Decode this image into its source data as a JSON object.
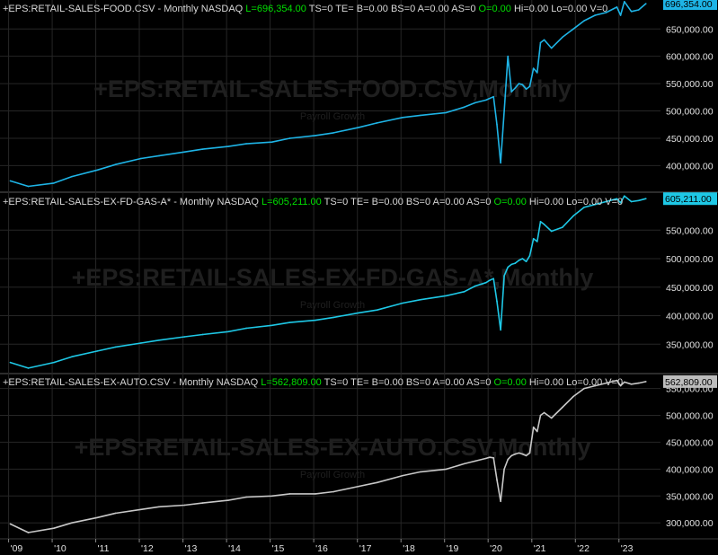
{
  "panels": [
    {
      "symbol": "+EPS:RETAIL-SALES-FOOD.CSV",
      "period": "Monthly",
      "exchange": "NASDAQ",
      "last_text": "L=696,354.00",
      "stats_pre": "TS=0  TE=  B=0.00  BS=0  A=0.00  AS=0",
      "open_text": "O=0.00",
      "stats_post": "Hi=0.00  Lo=0.00  V=0",
      "watermark": "+EPS:RETAIL-SALES-FOOD.CSV,Monthly",
      "watermark_sub": "Payroll Growth",
      "last_value_label": "696,354.00"
    },
    {
      "symbol": "+EPS:RETAIL-SALES-EX-FD-GAS-A*",
      "period": "Monthly",
      "exchange": "NASDAQ",
      "last_text": "L=605,211.00",
      "stats_pre": "TS=0  TE=  B=0.00  BS=0  A=0.00  AS=0",
      "open_text": "O=0.00",
      "stats_post": "Hi=0.00  Lo=0.00  V=0",
      "watermark": "+EPS:RETAIL-SALES-EX-FD-GAS-A*,Monthly",
      "watermark_sub": "Payroll Growth",
      "last_value_label": "605,211.00"
    },
    {
      "symbol": "+EPS:RETAIL-SALES-EX-AUTO.CSV",
      "period": "Monthly",
      "exchange": "NASDAQ",
      "last_text": "L=562,809.00",
      "stats_pre": "TS=0  TE=  B=0.00  BS=0  A=0.00  AS=0",
      "open_text": "O=0.00",
      "stats_post": "Hi=0.00  Lo=0.00  V=0",
      "watermark": "+EPS:RETAIL-SALES-EX-AUTO.CSV,Monthly",
      "watermark_sub": "Payroll Growth",
      "last_value_label": "562,809.00"
    }
  ],
  "colors": {
    "background": "#000000",
    "grid": "#262626",
    "divider": "#3a3a3a",
    "food_line": "#1eb4e6",
    "exfd_line": "#1ec8e6",
    "exauto_line": "#c8c8c8",
    "header_text": "#d8d8d8",
    "header_green": "#00e000"
  },
  "chart_data": [
    {
      "type": "line",
      "title": "+EPS:RETAIL-SALES-FOOD.CSV - Monthly NASDAQ",
      "xlabel": "",
      "ylabel": "",
      "x_tick_labels": [
        "'09",
        "'10",
        "'11",
        "'12",
        "'13",
        "'14",
        "'15",
        "'16",
        "'17",
        "'18",
        "'19",
        "'20",
        "'21",
        "'22",
        "'23"
      ],
      "y_ticks": [
        400000,
        450000,
        500000,
        550000,
        600000,
        650000
      ],
      "y_tick_labels": [
        "400,000.00",
        "450,000.00",
        "500,000.00",
        "550,000.00",
        "600,000.00",
        "650,000.00"
      ],
      "ylim": [
        353000,
        703000
      ],
      "grid": true,
      "series": [
        {
          "name": "",
          "x": [
            "2009-01",
            "2009-06",
            "2010-01",
            "2010-06",
            "2011-01",
            "2011-06",
            "2012-01",
            "2012-06",
            "2013-01",
            "2013-06",
            "2014-01",
            "2014-06",
            "2015-01",
            "2015-06",
            "2016-01",
            "2016-06",
            "2017-01",
            "2017-06",
            "2018-01",
            "2018-06",
            "2019-01",
            "2019-06",
            "2019-09",
            "2019-12",
            "2020-01",
            "2020-02",
            "2020-03",
            "2020-04",
            "2020-05",
            "2020-06",
            "2020-07",
            "2020-08",
            "2020-09",
            "2020-10",
            "2020-11",
            "2020-12",
            "2021-01",
            "2021-02",
            "2021-03",
            "2021-04",
            "2021-06",
            "2021-09",
            "2021-12",
            "2022-03",
            "2022-06",
            "2022-09",
            "2022-12",
            "2023-01",
            "2023-02",
            "2023-04",
            "2023-06",
            "2023-08"
          ],
          "values": [
            372000,
            362000,
            368000,
            380000,
            392000,
            402000,
            413000,
            418000,
            425000,
            430000,
            435000,
            440000,
            443000,
            450000,
            455000,
            460000,
            470000,
            478000,
            488000,
            492000,
            497000,
            507000,
            515000,
            520000,
            523000,
            526000,
            475000,
            405000,
            500000,
            600000,
            535000,
            542000,
            550000,
            548000,
            540000,
            545000,
            578000,
            570000,
            625000,
            630000,
            615000,
            635000,
            650000,
            665000,
            675000,
            680000,
            690000,
            675000,
            700000,
            682000,
            685000,
            696354
          ]
        }
      ]
    },
    {
      "type": "line",
      "title": "+EPS:RETAIL-SALES-EX-FD-GAS-A* - Monthly NASDAQ",
      "xlabel": "",
      "ylabel": "",
      "x_tick_labels": [
        "'09",
        "'10",
        "'11",
        "'12",
        "'13",
        "'14",
        "'15",
        "'16",
        "'17",
        "'18",
        "'19",
        "'20",
        "'21",
        "'22",
        "'23"
      ],
      "y_ticks": [
        350000,
        400000,
        450000,
        500000,
        550000
      ],
      "y_tick_labels": [
        "350,000.00",
        "400,000.00",
        "450,000.00",
        "500,000.00",
        "550,000.00"
      ],
      "ylim": [
        300000,
        615000
      ],
      "grid": true,
      "series": [
        {
          "name": "",
          "x": [
            "2009-01",
            "2009-06",
            "2010-01",
            "2010-06",
            "2011-01",
            "2011-06",
            "2012-01",
            "2012-06",
            "2013-01",
            "2013-06",
            "2014-01",
            "2014-06",
            "2015-01",
            "2015-06",
            "2016-01",
            "2016-06",
            "2017-01",
            "2017-06",
            "2018-01",
            "2018-06",
            "2019-01",
            "2019-06",
            "2019-09",
            "2019-12",
            "2020-01",
            "2020-02",
            "2020-03",
            "2020-04",
            "2020-05",
            "2020-06",
            "2020-07",
            "2020-08",
            "2020-09",
            "2020-10",
            "2020-11",
            "2020-12",
            "2021-01",
            "2021-02",
            "2021-03",
            "2021-04",
            "2021-06",
            "2021-09",
            "2021-12",
            "2022-03",
            "2022-06",
            "2022-09",
            "2022-12",
            "2023-01",
            "2023-02",
            "2023-04",
            "2023-06",
            "2023-08"
          ],
          "values": [
            318000,
            308000,
            318000,
            328000,
            338000,
            345000,
            352000,
            357000,
            363000,
            367000,
            372000,
            378000,
            383000,
            388000,
            392000,
            397000,
            405000,
            410000,
            422000,
            428000,
            435000,
            442000,
            452000,
            458000,
            462000,
            465000,
            425000,
            375000,
            470000,
            485000,
            490000,
            492000,
            497000,
            500000,
            495000,
            505000,
            535000,
            530000,
            565000,
            560000,
            548000,
            555000,
            575000,
            590000,
            595000,
            600000,
            605000,
            598000,
            610000,
            600000,
            602000,
            605211
          ]
        }
      ]
    },
    {
      "type": "line",
      "title": "+EPS:RETAIL-SALES-EX-AUTO.CSV - Monthly NASDAQ",
      "xlabel": "",
      "ylabel": "",
      "x_tick_labels": [
        "'09",
        "'10",
        "'11",
        "'12",
        "'13",
        "'14",
        "'15",
        "'16",
        "'17",
        "'18",
        "'19",
        "'20",
        "'21",
        "'22",
        "'23"
      ],
      "y_ticks": [
        300000,
        350000,
        400000,
        450000,
        500000,
        550000
      ],
      "y_tick_labels": [
        "300,000.00",
        "350,000.00",
        "400,000.00",
        "450,000.00",
        "500,000.00",
        "550,000.00"
      ],
      "ylim": [
        272000,
        576000
      ],
      "grid": true,
      "series": [
        {
          "name": "",
          "x": [
            "2009-01",
            "2009-06",
            "2010-01",
            "2010-06",
            "2011-01",
            "2011-06",
            "2012-01",
            "2012-06",
            "2013-01",
            "2013-06",
            "2014-01",
            "2014-06",
            "2015-01",
            "2015-06",
            "2016-01",
            "2016-06",
            "2017-01",
            "2017-06",
            "2018-01",
            "2018-06",
            "2019-01",
            "2019-06",
            "2019-09",
            "2019-12",
            "2020-01",
            "2020-02",
            "2020-03",
            "2020-04",
            "2020-05",
            "2020-06",
            "2020-07",
            "2020-08",
            "2020-09",
            "2020-10",
            "2020-11",
            "2020-12",
            "2021-01",
            "2021-02",
            "2021-03",
            "2021-04",
            "2021-06",
            "2021-09",
            "2021-12",
            "2022-03",
            "2022-06",
            "2022-09",
            "2022-12",
            "2023-01",
            "2023-02",
            "2023-04",
            "2023-06",
            "2023-08"
          ],
          "values": [
            298000,
            282000,
            290000,
            300000,
            310000,
            318000,
            325000,
            330000,
            333000,
            337000,
            342000,
            348000,
            350000,
            354000,
            354000,
            358000,
            368000,
            375000,
            388000,
            395000,
            400000,
            410000,
            415000,
            420000,
            422000,
            421000,
            380000,
            340000,
            400000,
            418000,
            425000,
            428000,
            430000,
            428000,
            425000,
            430000,
            478000,
            470000,
            500000,
            505000,
            495000,
            515000,
            535000,
            550000,
            555000,
            560000,
            565000,
            555000,
            562000,
            558000,
            560000,
            562809
          ]
        }
      ]
    }
  ]
}
